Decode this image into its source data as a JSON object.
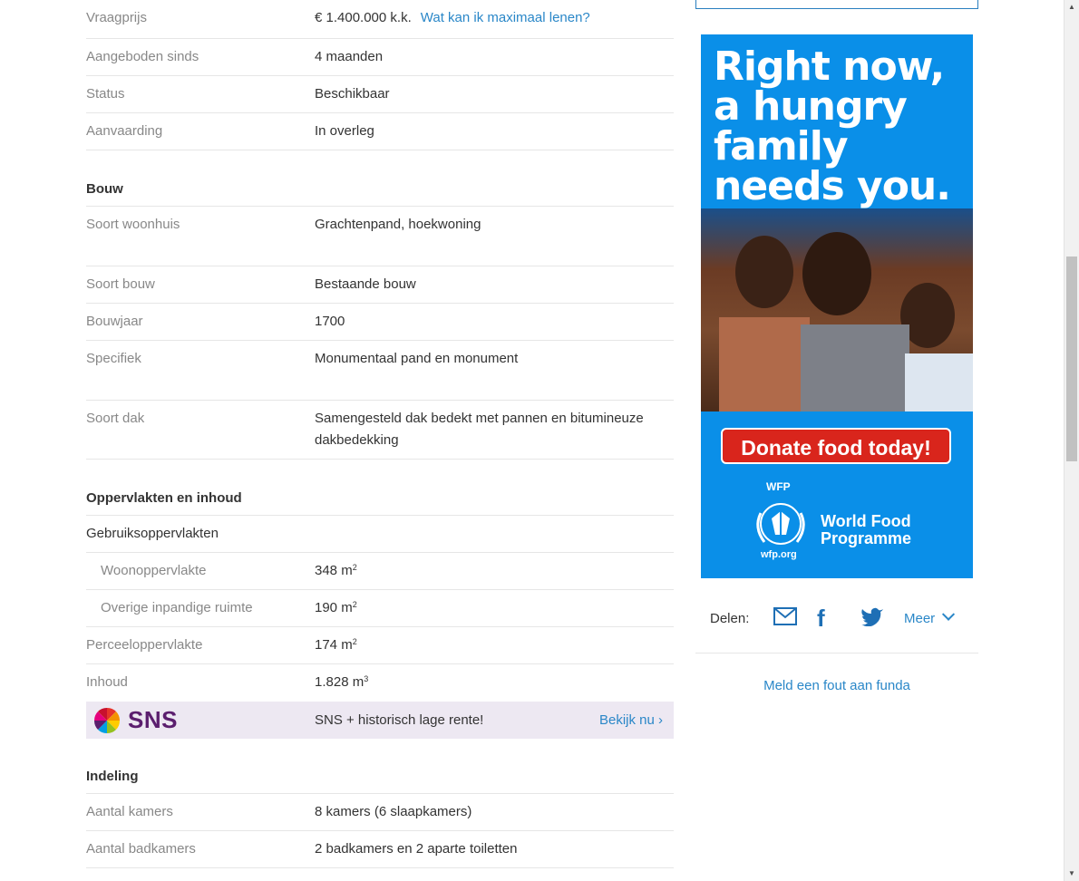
{
  "overdracht": [
    {
      "label": "Vraagprijs",
      "value": "€ 1.400.000 k.k.",
      "link": "Wat kan ik maximaal lenen?"
    },
    {
      "label": "Aangeboden sinds",
      "value": "4 maanden"
    },
    {
      "label": "Status",
      "value": "Beschikbaar"
    },
    {
      "label": "Aanvaarding",
      "value": "In overleg"
    }
  ],
  "bouw": {
    "title": "Bouw",
    "rows": [
      {
        "label": "Soort woonhuis",
        "value": "Grachtenpand, hoekwoning"
      },
      {
        "label": "Soort bouw",
        "value": "Bestaande bouw"
      },
      {
        "label": "Bouwjaar",
        "value": "1700"
      },
      {
        "label": "Specifiek",
        "value": "Monumentaal pand en monument"
      },
      {
        "label": "Soort dak",
        "value": "Samengesteld dak bedekt met pannen en bitumineuze dakbedekking"
      }
    ]
  },
  "oppervlakten": {
    "title": "Oppervlakten en inhoud",
    "gebruik_label": "Gebruiksoppervlakten",
    "rows": [
      {
        "label": "Woonoppervlakte",
        "value": "348 m",
        "unit_exp": "2"
      },
      {
        "label": "Overige inpandige ruimte",
        "value": "190 m",
        "unit_exp": "2"
      },
      {
        "label": "Perceeloppervlakte",
        "value": "174 m",
        "unit_exp": "2"
      },
      {
        "label": "Inhoud",
        "value": "1.828 m",
        "unit_exp": "3"
      }
    ]
  },
  "sns_ad": {
    "brand": "SNS",
    "message": "SNS + historisch lage rente!",
    "cta": "Bekijk nu ›"
  },
  "indeling": {
    "title": "Indeling",
    "rows": [
      {
        "label": "Aantal kamers",
        "value": "8 kamers (6 slaapkamers)"
      },
      {
        "label": "Aantal badkamers",
        "value": "2 badkamers en 2 aparte toiletten"
      }
    ]
  },
  "sidebar": {
    "ad": {
      "headline_lines": [
        "Right now,",
        "a hungry",
        "family",
        "needs you."
      ],
      "button": "Donate food today!",
      "logo_abbr": "WFP",
      "logo_name_lines": [
        "World Food",
        "Programme"
      ],
      "logo_url": "wfp.org"
    },
    "share": {
      "label": "Delen:",
      "more": "Meer"
    },
    "report": "Meld een fout aan funda"
  },
  "colors": {
    "link": "#2a87c8",
    "ad_bg": "#0a8fe8",
    "donate": "#d9251c",
    "sns_purple": "#5b1e6e"
  }
}
